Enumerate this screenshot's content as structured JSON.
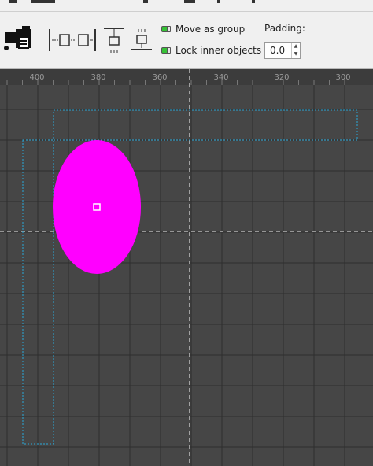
{
  "toolbar": {
    "move_as_group": {
      "label": "Move as group",
      "checked": true
    },
    "lock_inner_objects": {
      "label": "Lock inner objects",
      "checked": true
    },
    "padding": {
      "label": "Padding:",
      "value": "0.0"
    },
    "icons": [
      "print-fax-icon",
      "horizontal-spacing-icon",
      "distribute-horizontal-icon",
      "align-top-icon",
      "align-bottom-icon"
    ]
  },
  "ruler": {
    "labels": [
      "400",
      "380",
      "360",
      "340",
      "320",
      "300"
    ]
  },
  "canvas": {
    "background": "#464646",
    "grid_color": "#2e2e2e",
    "selection_color": "#2aa8d8",
    "ellipse_color": "#ff00ff"
  }
}
